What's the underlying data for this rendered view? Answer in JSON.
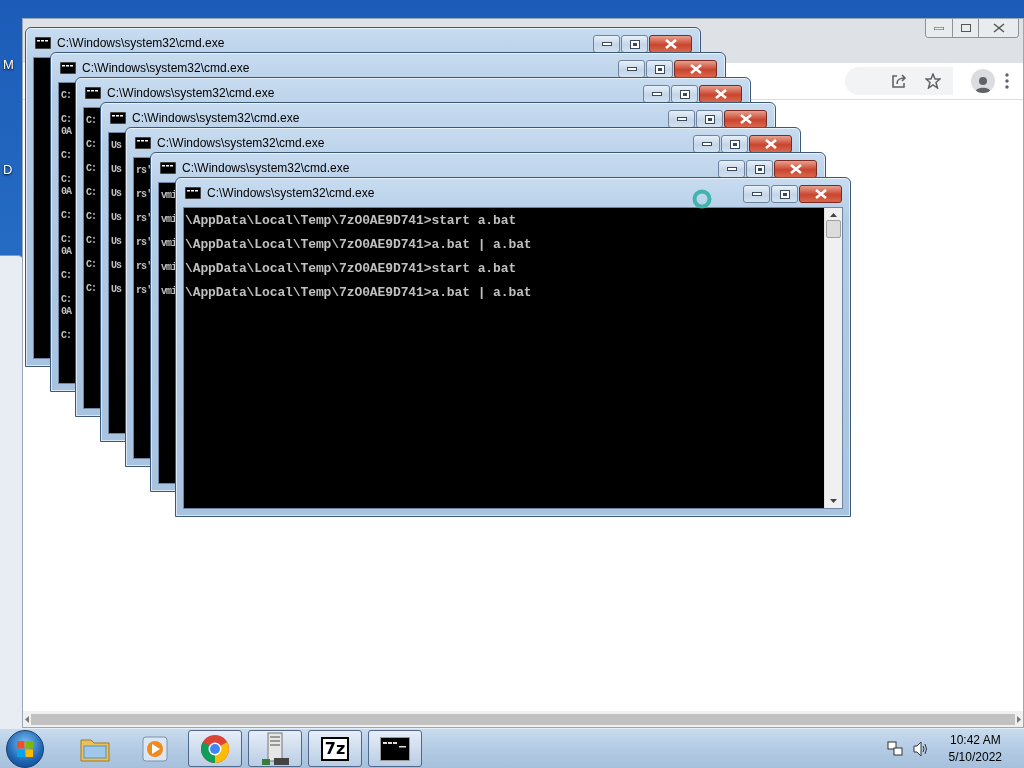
{
  "desktop": {
    "icon_labels": [
      "M",
      "D"
    ]
  },
  "cmd_windows": [
    {
      "title": "C:\\Windows\\system32\\cmd.exe"
    },
    {
      "title": "C:\\Windows\\system32\\cmd.exe",
      "lines": [
        {
          "kind": "text",
          "text": "C:"
        },
        {
          "kind": "blank"
        },
        {
          "kind": "text",
          "text": "C:"
        },
        {
          "kind": "text",
          "text": "0A"
        },
        {
          "kind": "blank"
        },
        {
          "kind": "text",
          "text": "C:"
        },
        {
          "kind": "blank"
        },
        {
          "kind": "text",
          "text": "C:"
        },
        {
          "kind": "text",
          "text": "0A"
        },
        {
          "kind": "blank"
        },
        {
          "kind": "text",
          "text": "C:"
        },
        {
          "kind": "blank"
        },
        {
          "kind": "text",
          "text": "C:"
        },
        {
          "kind": "text",
          "text": "0A"
        },
        {
          "kind": "blank"
        },
        {
          "kind": "text",
          "text": "C:"
        },
        {
          "kind": "blank"
        },
        {
          "kind": "text",
          "text": "C:"
        },
        {
          "kind": "text",
          "text": "0A"
        },
        {
          "kind": "blank"
        },
        {
          "kind": "text",
          "text": "C:"
        }
      ]
    },
    {
      "title": "C:\\Windows\\system32\\cmd.exe",
      "lines": [
        {
          "kind": "text",
          "text": "C:"
        },
        {
          "kind": "blank"
        },
        {
          "kind": "text",
          "text": "C:"
        },
        {
          "kind": "blank"
        },
        {
          "kind": "text",
          "text": "C:"
        },
        {
          "kind": "blank"
        },
        {
          "kind": "text",
          "text": "C:"
        },
        {
          "kind": "blank"
        },
        {
          "kind": "text",
          "text": "C:"
        },
        {
          "kind": "blank"
        },
        {
          "kind": "text",
          "text": "C:"
        },
        {
          "kind": "blank"
        },
        {
          "kind": "text",
          "text": "C:"
        },
        {
          "kind": "blank"
        },
        {
          "kind": "text",
          "text": "C:"
        }
      ]
    },
    {
      "title": "C:\\Windows\\system32\\cmd.exe",
      "lines": [
        {
          "kind": "text",
          "text": "Us"
        },
        {
          "kind": "blank"
        },
        {
          "kind": "text",
          "text": "Us"
        },
        {
          "kind": "blank"
        },
        {
          "kind": "text",
          "text": "Us"
        },
        {
          "kind": "blank"
        },
        {
          "kind": "text",
          "text": "Us"
        },
        {
          "kind": "blank"
        },
        {
          "kind": "text",
          "text": "Us"
        },
        {
          "kind": "blank"
        },
        {
          "kind": "text",
          "text": "Us"
        },
        {
          "kind": "blank"
        },
        {
          "kind": "text",
          "text": "Us"
        }
      ]
    },
    {
      "title": "C:\\Windows\\system32\\cmd.exe",
      "lines": [
        {
          "kind": "text",
          "text": "rs'"
        },
        {
          "kind": "blank"
        },
        {
          "kind": "text",
          "text": "rs'"
        },
        {
          "kind": "blank"
        },
        {
          "kind": "text",
          "text": "rs'"
        },
        {
          "kind": "blank"
        },
        {
          "kind": "text",
          "text": "rs'"
        },
        {
          "kind": "blank"
        },
        {
          "kind": "text",
          "text": "rs'"
        },
        {
          "kind": "blank"
        },
        {
          "kind": "text",
          "text": "rs'"
        }
      ]
    },
    {
      "title": "C:\\Windows\\system32\\cmd.exe",
      "lines": [
        {
          "kind": "text",
          "text": "vmi"
        },
        {
          "kind": "blank"
        },
        {
          "kind": "text",
          "text": "vmi"
        },
        {
          "kind": "blank"
        },
        {
          "kind": "text",
          "text": "vmi"
        },
        {
          "kind": "blank"
        },
        {
          "kind": "text",
          "text": "vmi"
        },
        {
          "kind": "blank"
        },
        {
          "kind": "text",
          "text": "vmi"
        }
      ]
    },
    {
      "title": "C:\\Windows\\system32\\cmd.exe",
      "lines": [
        {
          "kind": "text",
          "text": "\\AppData\\Local\\Temp\\7zO0AE9D741>start a.bat"
        },
        {
          "kind": "blank"
        },
        {
          "kind": "text",
          "text": "\\AppData\\Local\\Temp\\7zO0AE9D741>a.bat | a.bat"
        },
        {
          "kind": "blank"
        },
        {
          "kind": "text",
          "text": "\\AppData\\Local\\Temp\\7zO0AE9D741>start a.bat"
        },
        {
          "kind": "blank"
        },
        {
          "kind": "text",
          "text": "\\AppData\\Local\\Temp\\7zO0AE9D741>a.bat | a.bat"
        }
      ]
    }
  ],
  "taskbar": {
    "items": [
      {
        "kind": "start"
      },
      {
        "kind": "folder",
        "running": false
      },
      {
        "kind": "media",
        "running": false
      },
      {
        "kind": "chrome",
        "running": true
      },
      {
        "kind": "server",
        "running": true
      },
      {
        "kind": "archiver",
        "running": true,
        "label": "7z"
      },
      {
        "kind": "console",
        "running": true
      }
    ],
    "time": "10:42 AM",
    "date": "5/10/2022"
  }
}
